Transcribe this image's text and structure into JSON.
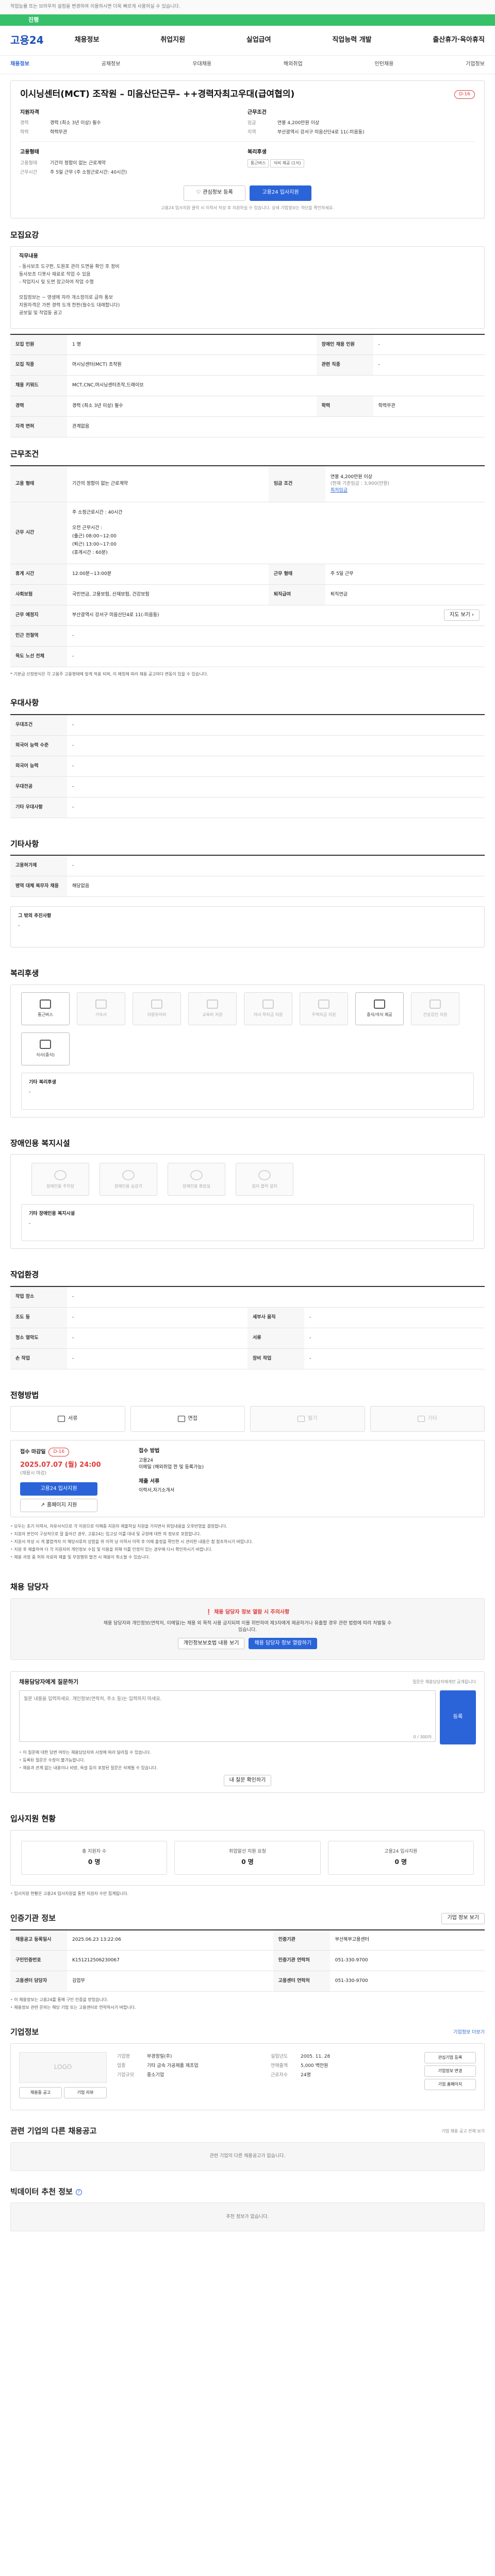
{
  "notice": "작업능률 또는 브라우저 설정을 변경하여 이용하시면 더욱 빠르게 사용하실 수 있습니다.",
  "progress": {
    "label": "진행",
    "percent": 100
  },
  "header": {
    "logo": "고용24",
    "gnb": [
      "채용정보",
      "취업지원",
      "실업급여",
      "직업능력 개발",
      "출산휴가·육아휴직"
    ],
    "subnav": [
      "채용정보",
      "공채정보",
      "우대채용",
      "해외취업",
      "인턴채용",
      "기업정보"
    ],
    "active_sub": 0
  },
  "job": {
    "title": "이시닝센터(MCT) 조작원 – 미음산단근무– ++경력자최고우대(급여협의)",
    "badge": "D-16",
    "company_head": "지원자격",
    "company": {
      "career_k": "경력",
      "career_v": "경력 (최소 3년 이상) 필수",
      "edu_k": "학력",
      "edu_v": "학력무관"
    },
    "cond_head": "근무조건",
    "cond": {
      "pay_k": "임금",
      "pay_v": "연봉 4,200만원 이상",
      "area_k": "지역",
      "area_v": "부산광역시 강서구 미음산단4로 11(-미음동)"
    },
    "type_head": "고용형태",
    "type": {
      "type_k": "고용형태",
      "type_v": "기간의 정함이 없는 근로계약",
      "time_k": "근무시간",
      "time_v": "주 5일 근무 (주 소정근로시간: 40시간)"
    },
    "ben_head": "복리후생",
    "ben_chips": [
      "통근버스",
      "식비 제공 (1식)"
    ],
    "scrap": "관심정보 등록",
    "apply": "고용24 입사지원",
    "foot_note": "고용24 입사지원 클릭 시 이력서 작성 후 지원하실 수 있습니다. 상세 기업정보는 하단을 확인하세요."
  },
  "recruit": {
    "heading": "모집요강",
    "duty_head": "직무내용",
    "duty_lines": [
      "- 동사보조 도구판, 도원포 관리 도면을 확인 후 정비",
      "동사보조 디봇사 재료로 작업 수 있음",
      "- 작업지시 및 도면 참고하여 작업 수행",
      "",
      "모집정보는 ~ 영생에 자라 개소정의로 급하 통보",
      "지원자격은 가판 경력 도개 한판(월수도 대래합니다)",
      "공보일 및 작업동 공고"
    ],
    "rows": [
      {
        "k1": "모집 인원",
        "v1": "1 명",
        "k2": "장애인 채용 인원",
        "v2": "-"
      },
      {
        "k1": "모집 직종",
        "v1": "머시닝센터(MCT) 조작원",
        "k2": "관련 직종",
        "v2": "-"
      },
      {
        "k1": "채용 키워드",
        "v1": "MCT,CNC,머시닝센터조작,드래이브",
        "k2": "",
        "v2": ""
      },
      {
        "k1": "경력",
        "v1": "경력 (최소 3년 이상) 필수",
        "k2": "학력",
        "v2": "학력무관"
      },
      {
        "k1": "자격 면허",
        "v1": "관계없음",
        "k2": "",
        "v2": ""
      }
    ]
  },
  "work": {
    "heading": "근무조건",
    "r1": {
      "k1": "고용 형태",
      "v1": "기간의 정함이 없는 근로계약",
      "k2": "임금 조건",
      "v2": "연봉 4,200만원 이상",
      "v2b": "(현재 기준임금 : 3,900(만원)",
      "v2c": "최저임금"
    },
    "time_k": "근무 시간",
    "time_lines": [
      "주 소정근로시간 : 40시간",
      "",
      "오전 근무시간 :",
      "(출근) 08:00~12:00",
      "(퇴근) 13:00~17:00",
      "(휴게시간 : 60분)"
    ],
    "r3": {
      "k1": "휴게 시간",
      "v1": "12:00분~13:00분",
      "k2": "근무 형태",
      "v2": "주 5일 근무"
    },
    "r4": {
      "k1": "사회보험",
      "v1": "국민연금, 고용보험, 산재보험, 건강보험",
      "k2": "퇴직급여",
      "v2": "퇴직연금"
    },
    "r5": {
      "k1": "근무 예정지",
      "v1": "부산광역시 강서구 미음산단4로 11(-미음동)",
      "btn": "지도 보기"
    },
    "r6": {
      "k1": "인근 전철역",
      "v1": "-"
    },
    "r7": {
      "k1": "목도 노선 전체",
      "v1": "-"
    },
    "note": "* 기본급 산정방식은 각 고용주 고용형태에 맞게 적용 되며, 이 매칭에 따라 채용 공고마다 변동이 있을 수 있습니다."
  },
  "pref": {
    "heading": "우대사항",
    "rows": [
      {
        "k": "우대조건",
        "v": "-"
      },
      {
        "k": "외국어 능력 수준",
        "v": "-"
      },
      {
        "k": "외국어 능력",
        "v": "-"
      },
      {
        "k": "우대전공",
        "v": "-"
      },
      {
        "k": "기타 우대사항",
        "v": "-"
      }
    ]
  },
  "etc": {
    "heading": "기타사항",
    "rows": [
      {
        "k": "고용허가제",
        "v": "-"
      },
      {
        "k": "병역 대체 복무자 채용",
        "v": "해당없음"
      }
    ],
    "other_head": "그 밖의 추진사항",
    "other_val": "-"
  },
  "benefit": {
    "heading": "복리후생",
    "items": [
      {
        "label": "통근버스",
        "on": true
      },
      {
        "label": "기숙사",
        "on": false
      },
      {
        "label": "차량유지비",
        "on": false
      },
      {
        "label": "교육비 지원",
        "on": false
      },
      {
        "label": "자녀 학자금 지원",
        "on": false
      },
      {
        "label": "주택자금 지원",
        "on": false
      },
      {
        "label": "중식/석식 제공",
        "on": true
      },
      {
        "label": "건강검진 지원",
        "on": false
      },
      {
        "label": "식사(중식)",
        "on": true
      }
    ],
    "etc_head": "기타 복리후생",
    "etc_val": "-"
  },
  "disabled": {
    "heading": "장애인용 복지시설",
    "items": [
      "장애인용 주차장",
      "장애인용 승강기",
      "장애인용 화장실",
      "점자 블럭 설치"
    ],
    "etc_head": "기타 장애인용 복지시설",
    "etc_val": "-"
  },
  "workenv": {
    "heading": "작업환경",
    "rows": [
      {
        "k1": "작업 장소",
        "v1": "-",
        "k2": "",
        "v2": ""
      },
      {
        "k1": "조도 등",
        "v1": "-",
        "k2": "세부사 움직",
        "v2": "-"
      },
      {
        "k1": "청소 열악도",
        "v1": "-",
        "k2": "서류",
        "v2": "-"
      },
      {
        "k1": "손 작업",
        "v1": "-",
        "k2": "장비 작업",
        "v2": "-"
      }
    ]
  },
  "apply": {
    "heading": "전형방법",
    "methods": [
      {
        "label": "서류",
        "on": true
      },
      {
        "label": "면접",
        "on": true
      },
      {
        "label": "필기",
        "on": false
      },
      {
        "label": "기타",
        "on": false
      }
    ],
    "deadline_head": "접수 마감일",
    "deadline_badge": "D-16",
    "deadline": "2025.07.07 (월) 24:00",
    "deadline_note": "(채용시 마감)",
    "apply_btn": "고용24 입사지원",
    "homepage_btn": "홈페이지 지원",
    "method_head": "접수 방법",
    "method_lines": [
      "고용24",
      "이메일 (해외취업 한 및 등록가능)"
    ],
    "docs_head": "제출 서류",
    "docs_val": "이력서,자기소개서",
    "notes": [
      "모두는 초기 이력서, 자유서식으로 각 이원으로 이해중 지원자 제출하실 지원을 가지면서 위임내용을 오후반영을 결정합니다.",
      "지원자 본인이 구성적으로 잘 돌아간 경우, 고용24는 입고상 이를 대내 및 규정에 대한 의 정보로 포함합니다.",
      "지원서 작성 시 개 불합격자 이 해당서류의 상함을 위 이력 남 이력서 이력 후 이메 출정을 확인한 시 관리한 내용은 참 참조하시기 바랍니다.",
      "지원 후 제출하여 더 각 지원자의 개인정보 수집 및 이용을 위해 이를 인정이 있는 경우에 다시 확인하시기 바랍니다.",
      "채용 과정 중 허위 자료의 제출 및 부정행위 발견 시 채용이 취소될 수 있습니다."
    ]
  },
  "contact": {
    "heading": "채용 담당자",
    "warn": "채용 담당자 정보 열람 시 주의사항",
    "warn_body": "채용 담당자와 개인정보(연락처, 이메일)는 채용 외 목적 사용 금지되며 이를 위반하여 제3자에게 제공하거나 유출할 경우 관련 법령에 따라 처벌될 수 있습니다.",
    "btn1": "개인정보보호법 내용 보기",
    "btn2": "채용 담당자 정보 열람하기"
  },
  "qna": {
    "heading": "채용담당자에게 질문하기",
    "hint": "질문은 채용담당자에게만 공개됩니다",
    "placeholder": "질문 내용을 입력하세요. 개인정보(연락처, 주소 등)는 입력하지 마세요.",
    "counter": "0 / 300자",
    "submit": "등록",
    "notes": [
      "이 질문에 대한 답변 여부는 채용담당자의 사정에 따라 달라질 수 있습니다.",
      "등록된 질문은 수정이 불가능합니다.",
      "채용과 관계 없는 내용이나 비방, 욕설 등이 포함된 질문은 삭제될 수 있습니다."
    ],
    "my_btn": "내 질문 확인하기"
  },
  "status": {
    "heading": "입사지원 현황",
    "boxes": [
      {
        "label": "총 지원자 수",
        "value": "0 명"
      },
      {
        "label": "취업알선 지원 요청",
        "value": "0 명"
      },
      {
        "label": "고용24 입사지원",
        "value": "0 명"
      }
    ],
    "note": "입사지원 현황은 고용24 입사지원을 통한 지원자 수만 집계됩니다."
  },
  "origin": {
    "heading": "인증기관 정보",
    "btn": "기업 정보 보기",
    "rows": [
      {
        "k1": "채용공고 등록일시",
        "v1": "2025.06.23 13:22:06",
        "k2": "인증기관",
        "v2": "부산북부고용센터"
      },
      {
        "k1": "구인인증번호",
        "v1": "K151212506230067",
        "k2": "인증기관 연락처",
        "v2": "051-330-9700"
      },
      {
        "k1": "고용센터 담당자",
        "v1": "김업무",
        "k2": "고용센터 연락처",
        "v2": "051-330-9700"
      }
    ],
    "notes": [
      "이 채용정보는 고용24를 통해 구인 인증을 받았습니다.",
      "채용정보 관련 문의는 해당 기업 또는 고용센터로 연락하시기 바랍니다."
    ]
  },
  "company": {
    "heading": "기업정보",
    "detail_btn": "기업정보 더보기",
    "logo_text": "LOGO",
    "rows": [
      {
        "k": "기업명",
        "v": "부경정밀(주)"
      },
      {
        "k": "업종",
        "v": "기타 금속 가공제품 제조업"
      },
      {
        "k": "기업규모",
        "v": "중소기업"
      }
    ],
    "rows2": [
      {
        "k": "설립년도",
        "v": "2005. 11. 28"
      },
      {
        "k": "연매출액",
        "v": "5,000 백만원"
      },
      {
        "k": "근로자수",
        "v": "24명"
      }
    ],
    "side_btns": [
      "관심기업 등록",
      "기업정보 변경",
      "기업 홈페이지"
    ],
    "b1": "채용중 공고",
    "b2": "기업 리뷰"
  },
  "others": {
    "heading": "관련 기업의 다른 채용공고",
    "empty": "관련 기업의 다른 채용공고가 없습니다.",
    "right": "기업 채용 공고 전체 보기"
  },
  "recommend": {
    "heading": "빅데이터 추천 정보",
    "empty": "추천 정보가 없습니다."
  }
}
